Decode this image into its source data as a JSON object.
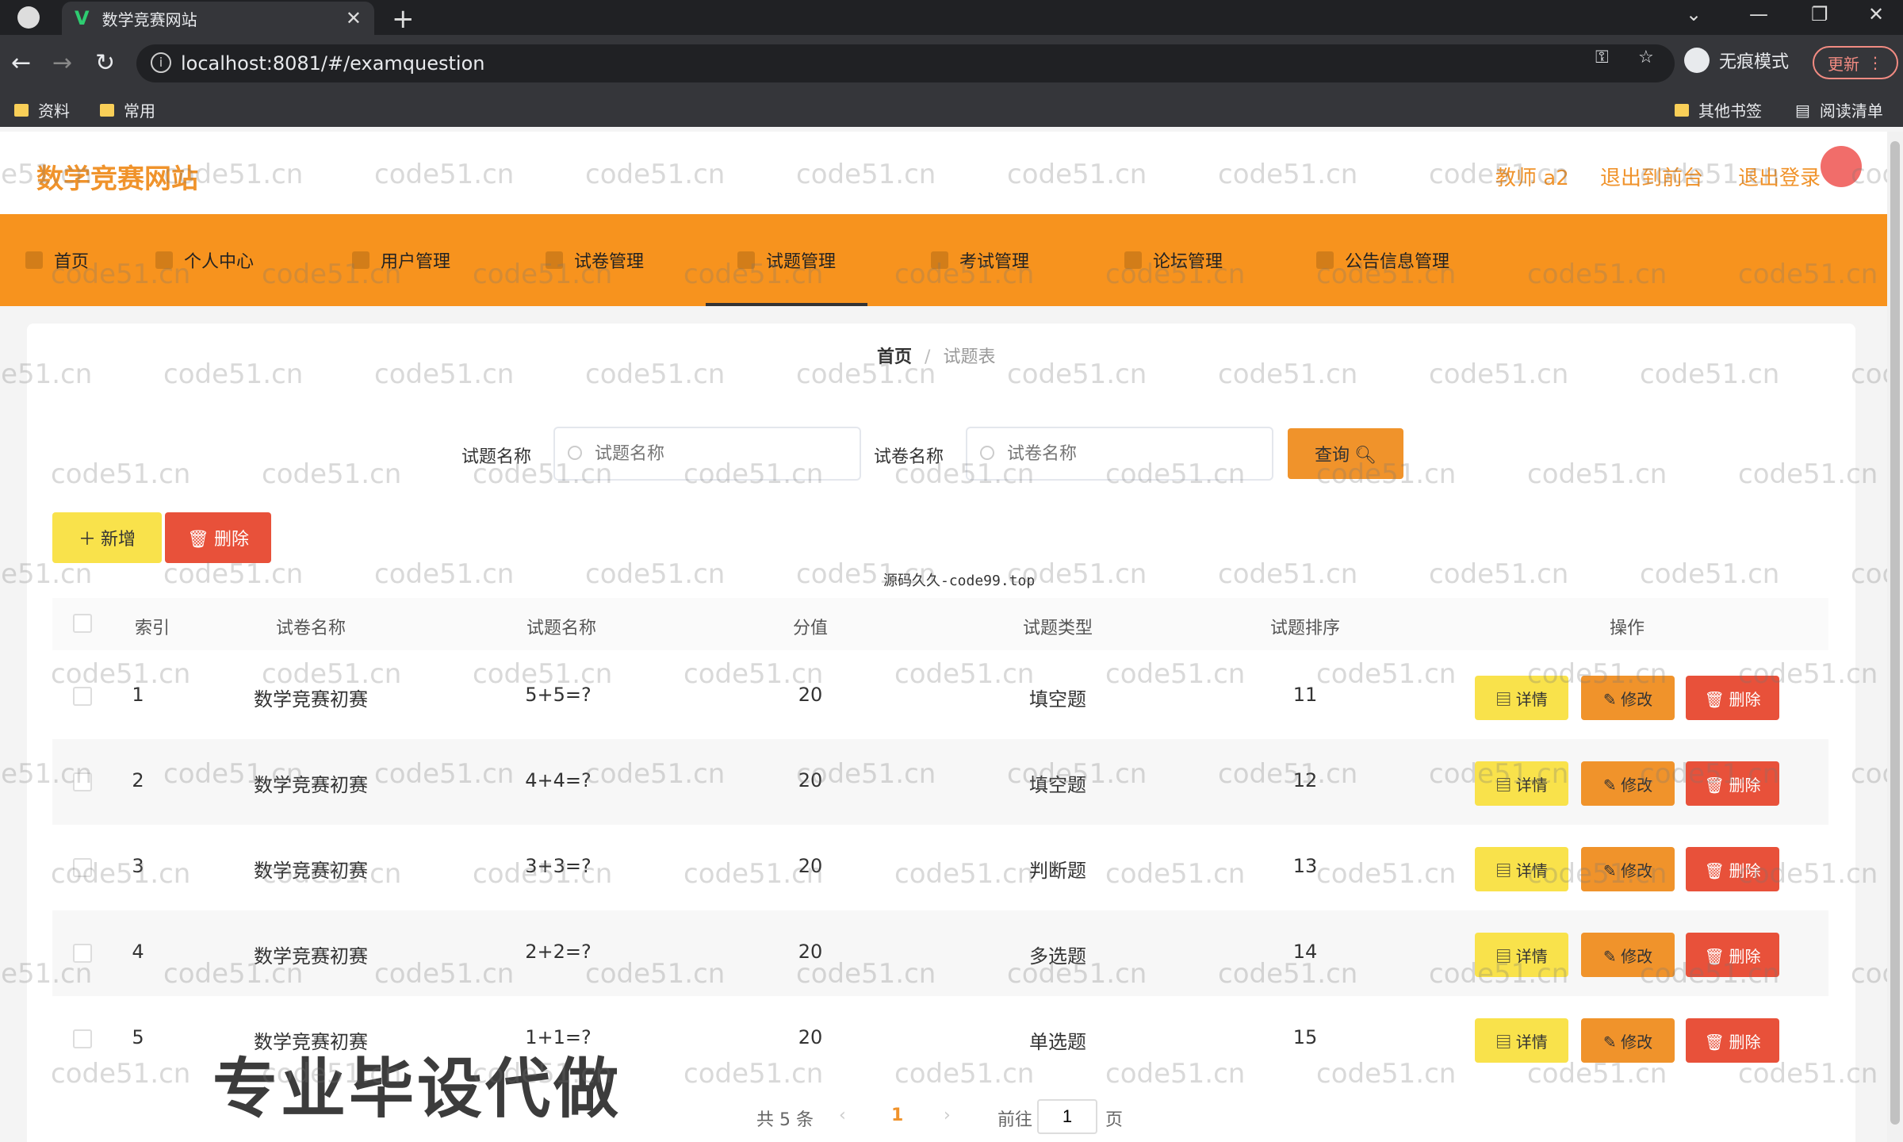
{
  "browser": {
    "tab_title": "数学竞赛网站",
    "url": "localhost:8081/#/examquestion",
    "incognito_label": "无痕模式",
    "update_label": "更新",
    "bookmarks": [
      "资料",
      "常用"
    ],
    "other_bookmarks": "其他书签",
    "reading_list": "阅读清单"
  },
  "header": {
    "site_title": "数学竞赛网站",
    "user": "教师 a2",
    "back_to_front": "退出到前台",
    "logout": "退出登录"
  },
  "menu": [
    {
      "label": "首页"
    },
    {
      "label": "个人中心"
    },
    {
      "label": "用户管理"
    },
    {
      "label": "试卷管理"
    },
    {
      "label": "试题管理"
    },
    {
      "label": "考试管理"
    },
    {
      "label": "论坛管理"
    },
    {
      "label": "公告信息管理"
    }
  ],
  "breadcrumb": {
    "home": "首页",
    "sep": "/",
    "current": "试题表"
  },
  "filters": {
    "question_label": "试题名称",
    "question_placeholder": "试题名称",
    "paper_label": "试卷名称",
    "paper_placeholder": "试卷名称",
    "query_button": "查询"
  },
  "actions": {
    "add": "＋ 新增",
    "delete": "删除"
  },
  "source_watermark": "源码久久-code99.top",
  "table": {
    "headers": [
      "索引",
      "试卷名称",
      "试题名称",
      "分值",
      "试题类型",
      "试题排序",
      "操作"
    ],
    "rows": [
      {
        "index": "1",
        "paper": "数学竞赛初赛",
        "question": "5+5=?",
        "score": "20",
        "type": "填空题",
        "order": "11"
      },
      {
        "index": "2",
        "paper": "数学竞赛初赛",
        "question": "4+4=?",
        "score": "20",
        "type": "填空题",
        "order": "12"
      },
      {
        "index": "3",
        "paper": "数学竞赛初赛",
        "question": "3+3=?",
        "score": "20",
        "type": "判断题",
        "order": "13"
      },
      {
        "index": "4",
        "paper": "数学竞赛初赛",
        "question": "2+2=?",
        "score": "20",
        "type": "多选题",
        "order": "14"
      },
      {
        "index": "5",
        "paper": "数学竞赛初赛",
        "question": "1+1=?",
        "score": "20",
        "type": "单选题",
        "order": "15"
      }
    ],
    "row_buttons": {
      "detail": "详情",
      "edit": "修改",
      "delete": "删除"
    }
  },
  "pagination": {
    "total": "共 5 条",
    "current": "1",
    "goto": "前往",
    "page_value": "1",
    "page_suffix": "页"
  },
  "overlay_text": "专业毕设代做",
  "watermark_text": "code51.cn",
  "colors": {
    "accent": "#f0932b",
    "menu_bg": "#f7931e",
    "danger": "#e8513a",
    "yellow": "#f9e24b"
  }
}
